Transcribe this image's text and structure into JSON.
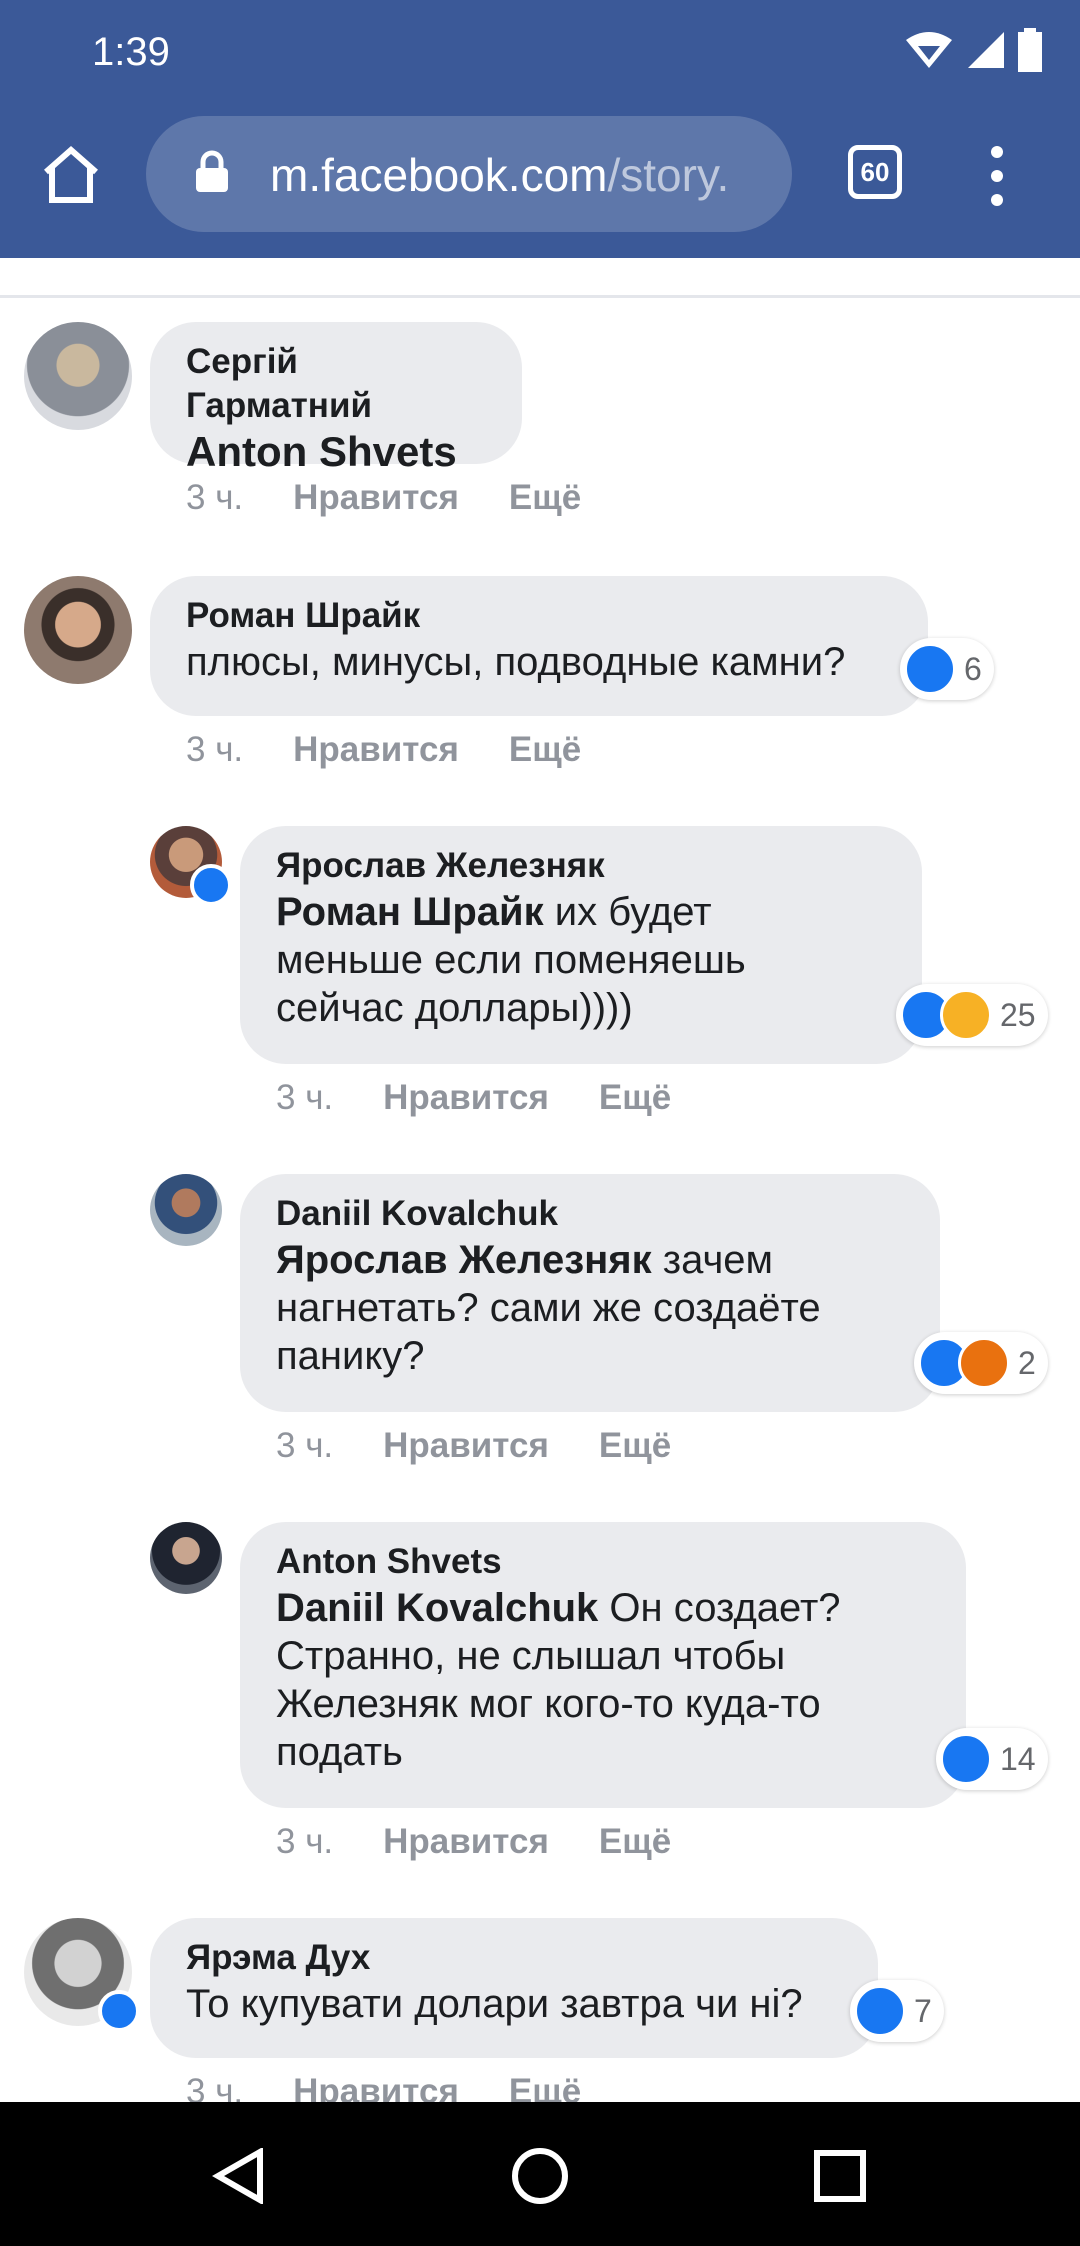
{
  "status": {
    "time": "1:39"
  },
  "browser": {
    "url_host": "m.facebook.com",
    "url_path": "/story.",
    "tab_count": "60"
  },
  "comments": [
    {
      "author": "Сергій Гарматний",
      "mention": "Anton Shvets",
      "text": "",
      "time": "3 ч.",
      "like": "Нравится",
      "more": "Ещё"
    },
    {
      "author": "Роман Шрайк",
      "mention": "",
      "text": "плюсы, минусы, подводные камни?",
      "time": "3 ч.",
      "like": "Нравится",
      "more": "Ещё",
      "reaction_count": "6"
    },
    {
      "author": "Ярослав Железняк",
      "mention": "Роман Шрайк",
      "text_l1": " их будет",
      "text_l2": "меньше если поменяешь",
      "text_l3": "сейчас доллары))))",
      "time": "3 ч.",
      "like": "Нравится",
      "more": "Ещё",
      "reaction_count": "25"
    },
    {
      "author": "Daniil Kovalchuk",
      "mention": "Ярослав Железняк",
      "text_l1": " зачем",
      "text_l2": "нагнетать? сами же создаёте",
      "text_l3": "панику?",
      "time": "3 ч.",
      "like": "Нравится",
      "more": "Ещё",
      "reaction_count": "2"
    },
    {
      "author": "Anton Shvets",
      "mention": "Daniil Kovalchuk",
      "text_l1": " Он создает?",
      "text_l2": "Странно, не слышал чтобы",
      "text_l3": "Железняк мог кого-то куда-то",
      "text_l4": "подать",
      "time": "3 ч.",
      "like": "Нравится",
      "more": "Ещё",
      "reaction_count": "14"
    },
    {
      "author": "Ярэма Дух",
      "mention": "",
      "text": "То купувати долари завтра чи ні?",
      "time": "3 ч.",
      "like": "Нравится",
      "more": "Ещё",
      "reaction_count": "7"
    }
  ]
}
